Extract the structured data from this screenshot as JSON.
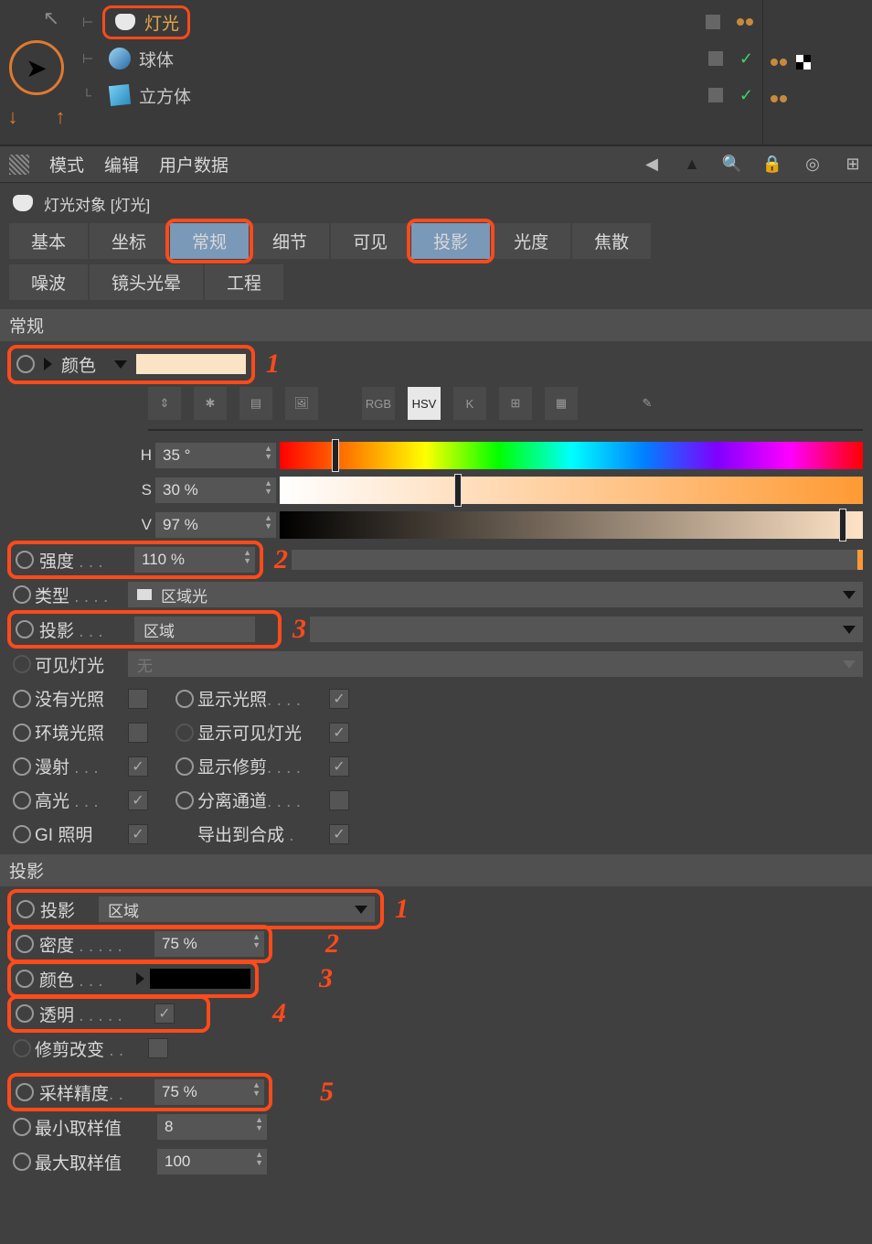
{
  "objects": {
    "items": [
      {
        "name": "灯光",
        "icon": "light"
      },
      {
        "name": "球体",
        "icon": "sphere"
      },
      {
        "name": "立方体",
        "icon": "cube"
      }
    ]
  },
  "mode_bar": {
    "mode": "模式",
    "edit": "编辑",
    "user_data": "用户数据"
  },
  "object_title": "灯光对象 [灯光]",
  "tabs_row1": {
    "basic": "基本",
    "coords": "坐标",
    "general": "常规",
    "detail": "细节",
    "visible": "可见",
    "shadow": "投影",
    "photometric": "光度",
    "caustics": "焦散"
  },
  "tabs_row2": {
    "noise": "噪波",
    "lens": "镜头光晕",
    "project": "工程"
  },
  "general_section": {
    "title": "常规",
    "color_label": "颜色",
    "color_hex": "#fbe3c5",
    "H_label": "H",
    "H_val": "35 °",
    "S_label": "S",
    "S_val": "30 %",
    "V_label": "V",
    "V_val": "97 %",
    "intensity_label": "强度",
    "intensity_val": "110 %",
    "type_label": "类型",
    "type_val": "区域光",
    "shadow_label": "投影",
    "shadow_val": "区域",
    "vis_light_label": "可见灯光",
    "vis_light_val": "无",
    "no_illum": "没有光照",
    "ambient": "环境光照",
    "diffuse": "漫射",
    "specular": "高光",
    "gi": "GI 照明",
    "show_illum": "显示光照",
    "show_vis": "显示可见灯光",
    "show_clip": "显示修剪",
    "sep_pass": "分离通道",
    "export_comp": "导出到合成"
  },
  "shadow_section": {
    "title": "投影",
    "shadow_label": "投影",
    "shadow_val": "区域",
    "density_label": "密度",
    "density_val": "75 %",
    "color_label": "颜色",
    "color_hex": "#000000",
    "transp_label": "透明",
    "clip_label": "修剪改变",
    "sampling_label": "采样精度",
    "sampling_val": "75 %",
    "min_samples_label": "最小取样值",
    "min_samples_val": "8",
    "max_samples_label": "最大取样值",
    "max_samples_val": "100"
  },
  "icon_strip": {
    "rgb": "RGB",
    "hsv": "HSV",
    "k": "K"
  },
  "annotations": {
    "a1": "1",
    "a2": "2",
    "a3": "3",
    "b1": "1",
    "b2": "2",
    "b3": "3",
    "b4": "4",
    "b5": "5"
  }
}
